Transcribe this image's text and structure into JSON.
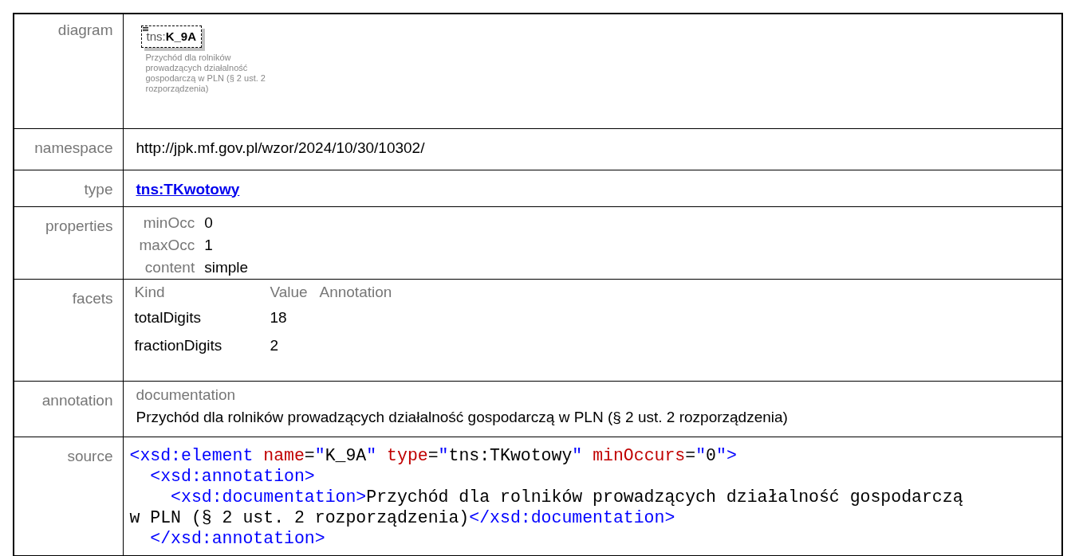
{
  "rows": [
    {
      "label": "diagram",
      "kind": "diagram",
      "element": {
        "prefix": "tns:",
        "name": "K_9A",
        "optional": true,
        "description": "Przychód dla rolników prowadzących działalność gospodarczą w PLN (§ 2 ust. 2 rozporządzenia)"
      }
    },
    {
      "label": "namespace",
      "kind": "text",
      "text": "http://jpk.mf.gov.pl/wzor/2024/10/30/10302/"
    },
    {
      "label": "type",
      "kind": "link",
      "text": "tns:TKwotowy"
    },
    {
      "label": "properties",
      "kind": "properties",
      "items": [
        {
          "name": "minOcc",
          "value": "0"
        },
        {
          "name": "maxOcc",
          "value": "1"
        },
        {
          "name": "content",
          "value": "simple"
        }
      ]
    },
    {
      "label": "facets",
      "kind": "facets",
      "columns": [
        "Kind",
        "Value",
        "Annotation"
      ],
      "items": [
        {
          "kind": "totalDigits",
          "value": "18"
        },
        {
          "kind": "fractionDigits",
          "value": "2"
        }
      ]
    },
    {
      "label": "annotation",
      "kind": "annotation",
      "heading": "documentation",
      "text": "Przychód dla rolników prowadzących działalność gospodarczą w PLN (§ 2 ust. 2 rozporządzenia)"
    },
    {
      "label": "source",
      "kind": "source",
      "lines": [
        [
          {
            "kind": "tag",
            "s": "<xsd:element"
          },
          {
            "kind": "attr",
            "s": " name"
          },
          {
            "kind": "text",
            "s": "="
          },
          {
            "kind": "tag",
            "s": "\""
          },
          {
            "kind": "text",
            "s": "K_9A"
          },
          {
            "kind": "tag",
            "s": "\""
          },
          {
            "kind": "attr",
            "s": " type"
          },
          {
            "kind": "text",
            "s": "="
          },
          {
            "kind": "tag",
            "s": "\""
          },
          {
            "kind": "text",
            "s": "tns:TKwotowy"
          },
          {
            "kind": "tag",
            "s": "\""
          },
          {
            "kind": "attr",
            "s": " minOccurs"
          },
          {
            "kind": "text",
            "s": "="
          },
          {
            "kind": "tag",
            "s": "\""
          },
          {
            "kind": "text",
            "s": "0"
          },
          {
            "kind": "tag",
            "s": "\">"
          }
        ],
        [
          {
            "kind": "tag",
            "s": "  <xsd:annotation>"
          }
        ],
        [
          {
            "kind": "tag",
            "s": "    <xsd:documentation>"
          },
          {
            "kind": "text",
            "s": "Przychód dla rolników prowadzących działalność gospodarczą"
          }
        ],
        [
          {
            "kind": "text",
            "s": "w PLN (§ 2 ust. 2 rozporządzenia)"
          },
          {
            "kind": "tag",
            "s": "</xsd:documentation>"
          }
        ],
        [
          {
            "kind": "tag",
            "s": "  </xsd:annotation>"
          }
        ]
      ]
    }
  ]
}
